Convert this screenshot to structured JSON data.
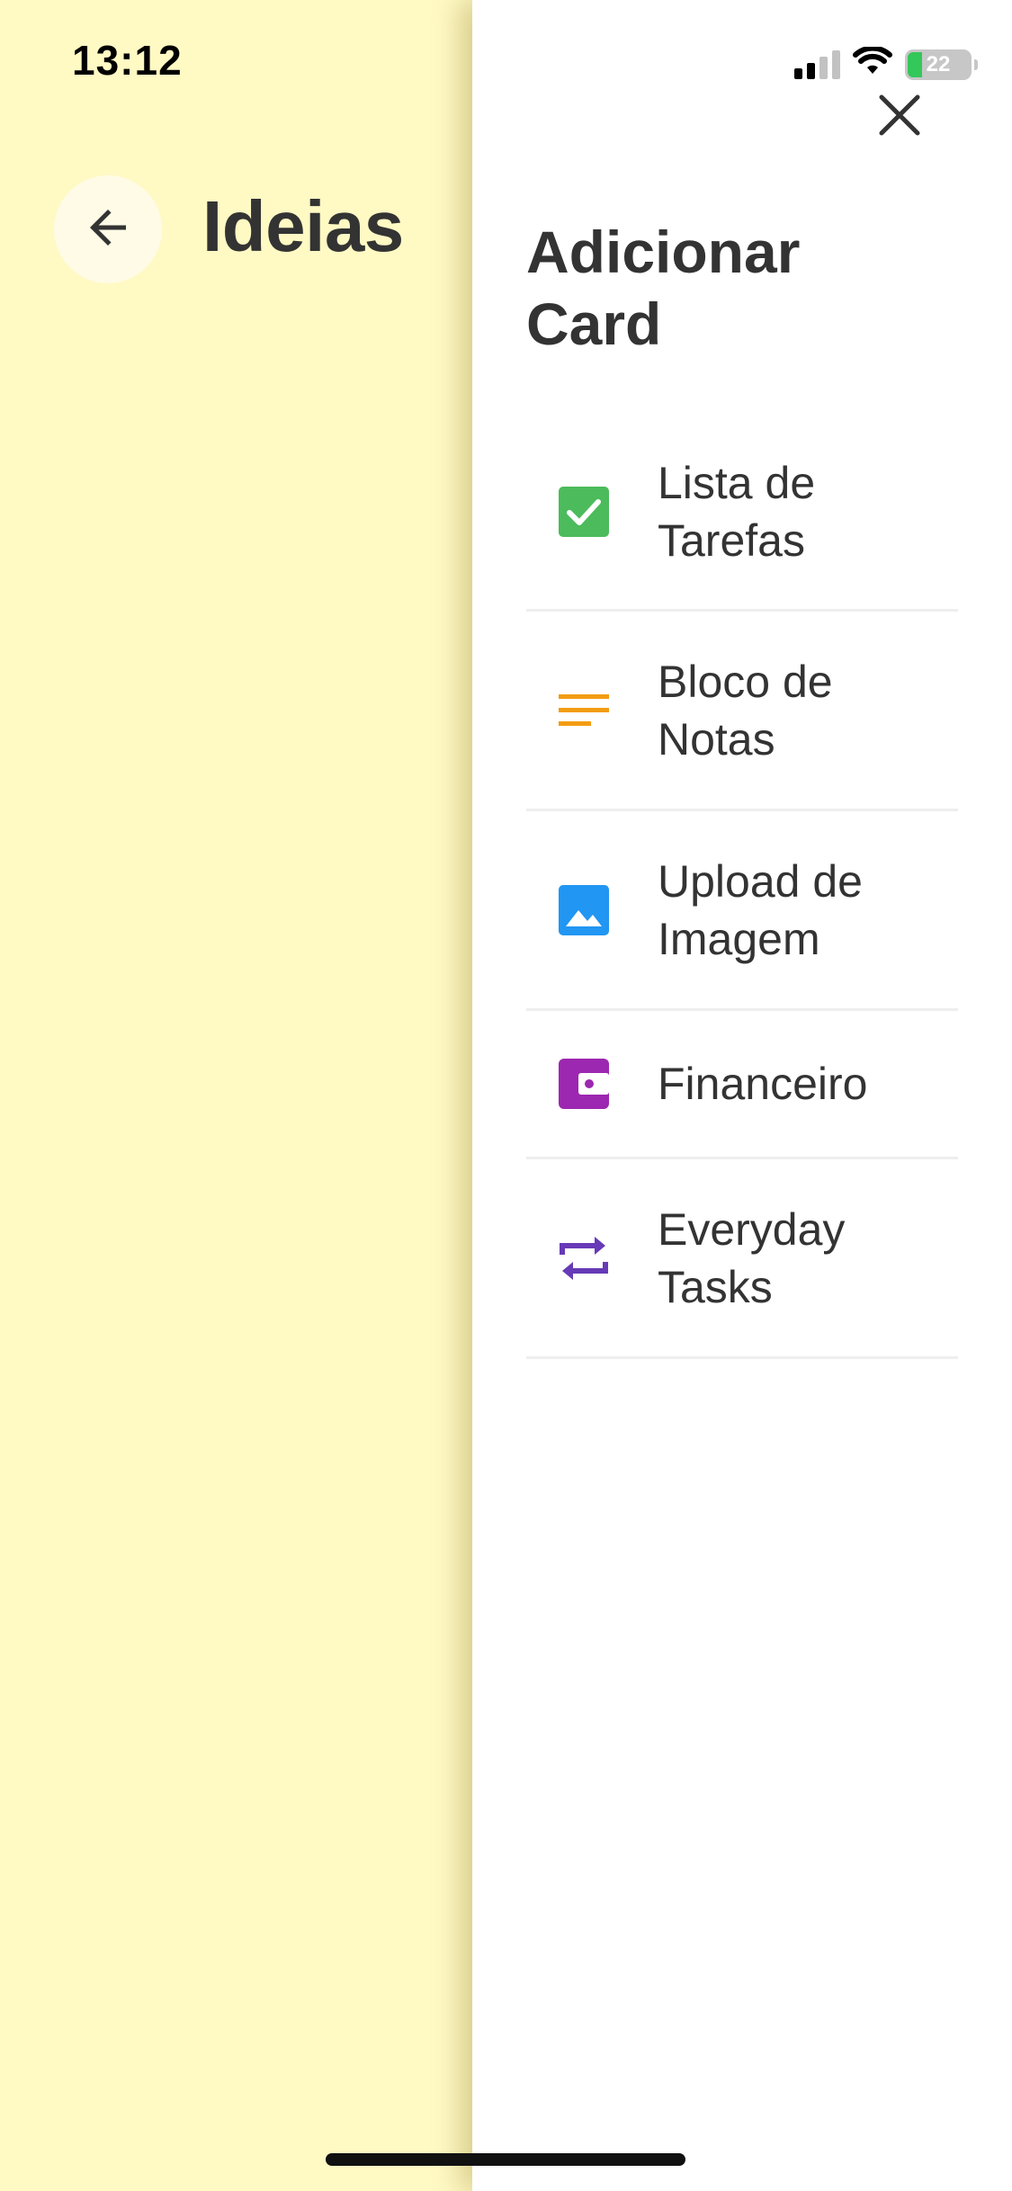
{
  "status_bar": {
    "time": "13:12",
    "battery_percent": "22",
    "battery_level": 0.22
  },
  "page": {
    "title": "Ideias",
    "background_color": "#fff9c4"
  },
  "drawer": {
    "title": "Adicionar Card",
    "items": [
      {
        "label": "Lista de\nTarefas",
        "icon": "checkbox-icon",
        "color": "#4cbb5c"
      },
      {
        "label": "Bloco de\nNotas",
        "icon": "notes-lines-icon",
        "color": "#f39c12"
      },
      {
        "label": "Upload de\nImagem",
        "icon": "image-icon",
        "color": "#2196f3"
      },
      {
        "label": "Financeiro",
        "icon": "wallet-icon",
        "color": "#9c27b0"
      },
      {
        "label": "Everyday\nTasks",
        "icon": "repeat-icon",
        "color": "#673ab7"
      }
    ]
  }
}
